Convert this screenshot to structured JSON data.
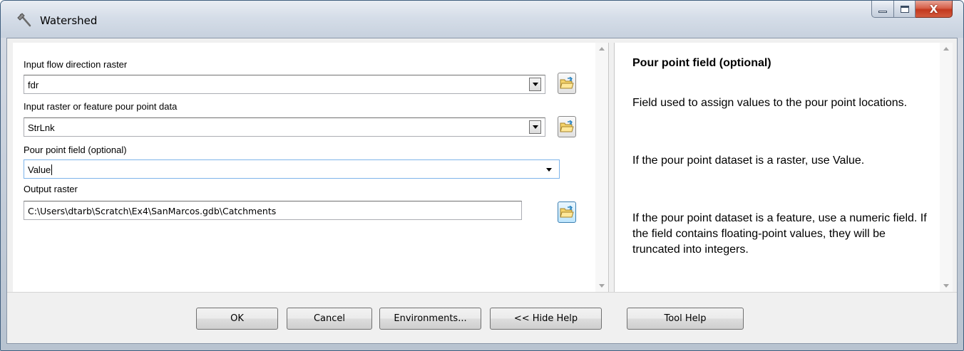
{
  "window": {
    "title": "Watershed",
    "close_glyph": "X"
  },
  "params": {
    "flow_direction": {
      "label": "Input flow direction raster",
      "value": "fdr"
    },
    "pour_point_data": {
      "label": "Input raster or feature pour point data",
      "value": "StrLnk"
    },
    "pour_point_field": {
      "label": "Pour point field (optional)",
      "value": "Value"
    },
    "output_raster": {
      "label": "Output raster",
      "value": "C:\\Users\\dtarb\\Scratch\\Ex4\\SanMarcos.gdb\\Catchments"
    }
  },
  "help": {
    "heading": "Pour point field (optional)",
    "paragraphs": [
      "Field used to assign values to the pour point locations.",
      "If the pour point dataset is a raster, use Value.",
      "If the pour point dataset is a feature, use a numeric field. If the field contains floating-point values, they will be truncated into integers."
    ]
  },
  "buttons": {
    "ok": "OK",
    "cancel": "Cancel",
    "environments": "Environments...",
    "hide_help": "<< Hide Help",
    "tool_help": "Tool Help"
  },
  "icons": {
    "title": "hammer-icon",
    "browse": "open-folder-icon"
  },
  "colors": {
    "close_button": "#c3391f",
    "focus_border": "#7eb4ea"
  }
}
